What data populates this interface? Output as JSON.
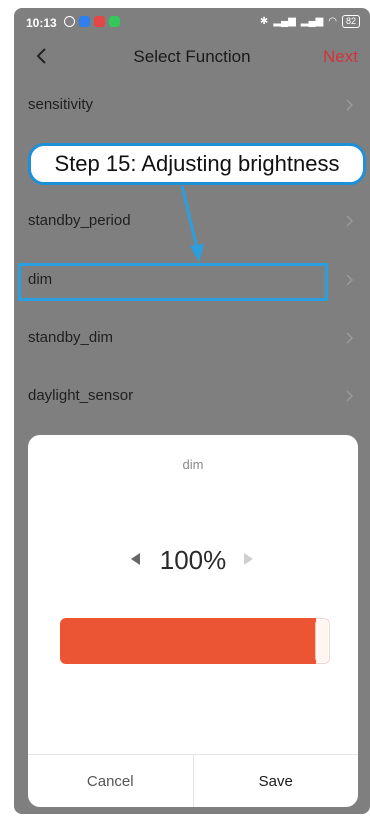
{
  "status_bar": {
    "time": "10:13",
    "battery": "82"
  },
  "header": {
    "title": "Select Function",
    "next_label": "Next",
    "next_color": "#d2323a"
  },
  "list": {
    "items": [
      {
        "label": "sensitivity"
      },
      {
        "label": ""
      },
      {
        "label": "standby_period"
      },
      {
        "label": "dim"
      },
      {
        "label": "standby_dim"
      },
      {
        "label": "daylight_sensor"
      }
    ]
  },
  "annotation": {
    "callout_text": "Step 15: Adjusting brightness",
    "color": "#1e90d8"
  },
  "sheet": {
    "title": "dim",
    "value_text": "100%",
    "level_percent": 100,
    "accent_color": "#ec5533",
    "cancel_label": "Cancel",
    "save_label": "Save"
  }
}
